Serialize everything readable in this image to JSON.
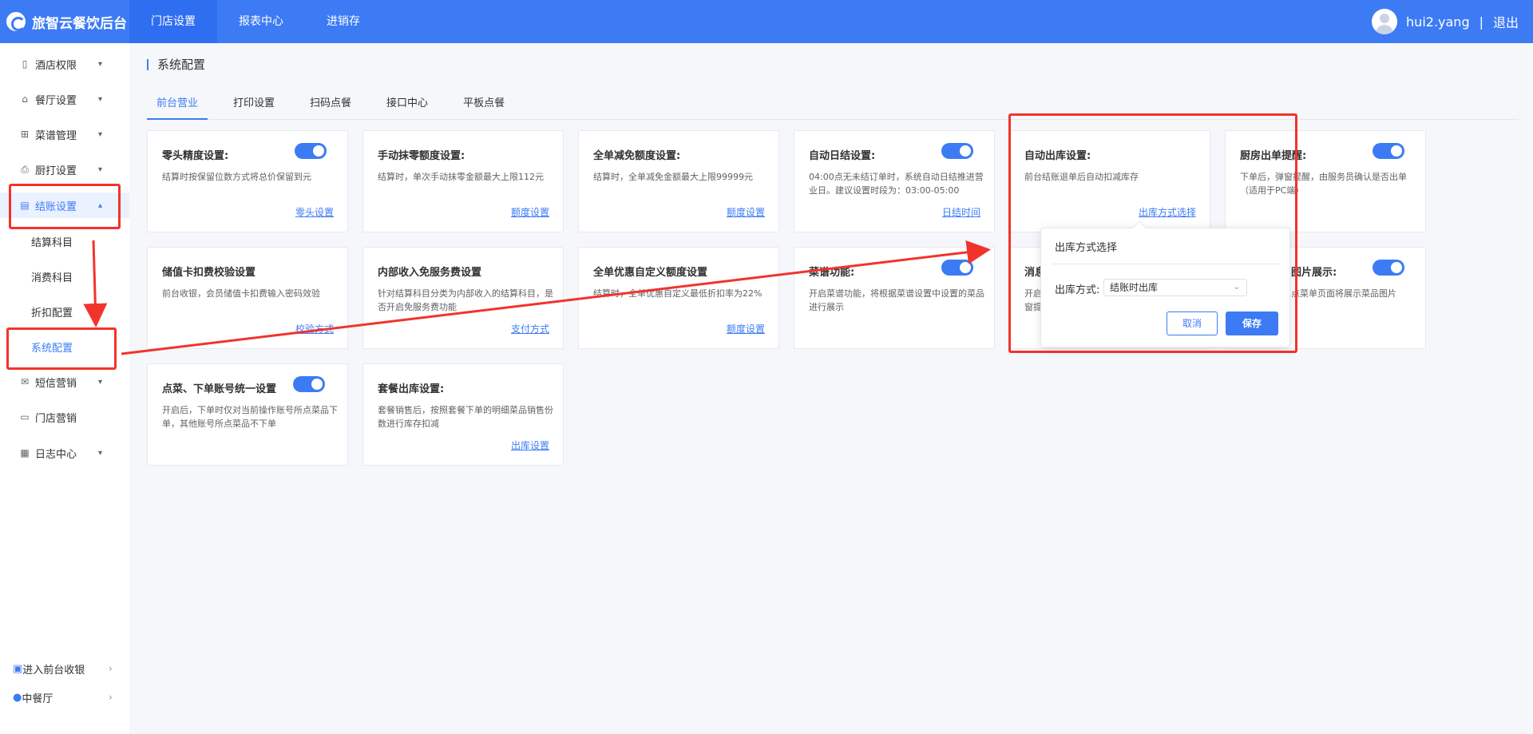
{
  "app": {
    "title": "旅智云餐饮后台"
  },
  "topnav": [
    {
      "label": "门店设置",
      "active": true
    },
    {
      "label": "报表中心",
      "active": false
    },
    {
      "label": "进销存",
      "active": false
    }
  ],
  "user": {
    "name": "hui2.yang",
    "separator": "|",
    "logout": "退出"
  },
  "sidebar": {
    "items": [
      {
        "label": "酒店权限",
        "icon": "building-icon"
      },
      {
        "label": "餐厅设置",
        "icon": "home-icon"
      },
      {
        "label": "菜谱管理",
        "icon": "grid-icon"
      },
      {
        "label": "厨打设置",
        "icon": "printer-icon"
      },
      {
        "label": "结账设置",
        "icon": "bill-icon",
        "open": true
      },
      {
        "label": "短信营销",
        "icon": "mail-icon"
      },
      {
        "label": "门店营销",
        "icon": "store-icon"
      },
      {
        "label": "日志中心",
        "icon": "log-icon"
      }
    ],
    "sub_items": [
      {
        "label": "结算科目"
      },
      {
        "label": "消费科目"
      },
      {
        "label": "折扣配置"
      },
      {
        "label": "系统配置",
        "active": true
      }
    ],
    "bottom": [
      {
        "label": "进入前台收银",
        "icon": "monitor-icon"
      },
      {
        "label": "中餐厅",
        "icon": "location-icon"
      }
    ]
  },
  "page": {
    "title": "系统配置",
    "tabs": [
      {
        "label": "前台营业",
        "active": true
      },
      {
        "label": "打印设置",
        "active": false
      },
      {
        "label": "扫码点餐",
        "active": false
      },
      {
        "label": "接口中心",
        "active": false
      },
      {
        "label": "平板点餐",
        "active": false
      }
    ]
  },
  "cards": [
    {
      "title": "零头精度设置:",
      "desc": "结算时按保留位数方式将总价保留到元",
      "link": "零头设置",
      "toggle": true
    },
    {
      "title": "手动抹零额度设置:",
      "desc": "结算时，单次手动抹零金额最大上限112元",
      "link": "额度设置",
      "toggle": false
    },
    {
      "title": "全单减免额度设置:",
      "desc": "结算时，全单减免金额最大上限99999元",
      "link": "额度设置",
      "toggle": false
    },
    {
      "title": "自动日结设置:",
      "desc": "04:00点无未结订单时，系统自动日结推进营业日。建议设置时段为：03:00-05:00",
      "link": "日结时间",
      "toggle": true
    },
    {
      "title": "自动出库设置:",
      "desc": "前台结账退单后自动扣减库存",
      "link": "出库方式选择",
      "toggle": false
    },
    {
      "title": "厨房出单提醒:",
      "desc": "下单后，弹窗提醒，由服务员确认是否出单（适用于PC端）",
      "link": "",
      "toggle": true
    },
    {
      "title": "储值卡扣费校验设置",
      "desc": "前台收银，会员储值卡扣费输入密码效验",
      "link": "校验方式",
      "toggle": false
    },
    {
      "title": "内部收入免服务费设置",
      "desc": "针对结算科目分类为内部收入的结算科目，是否开启免服务费功能",
      "link": "支付方式",
      "toggle": false
    },
    {
      "title": "全单优惠自定义额度设置",
      "desc": "结算时，全单优惠自定义最低折扣率为22%",
      "link": "额度设置",
      "toggle": false
    },
    {
      "title": "菜谱功能:",
      "desc": "开启菜谱功能，将根据菜谱设置中设置的菜品进行展示",
      "link": "",
      "toggle": true
    },
    {
      "title": "消息",
      "desc": "开启窗提",
      "link": "",
      "toggle": false
    },
    {
      "title": "图片展示:",
      "desc": "点菜单页面将展示菜品图片",
      "link": "",
      "toggle": true
    },
    {
      "title": "点菜、下单账号统一设置",
      "desc": "开启后，下单时仅对当前操作账号所点菜品下单，其他账号所点菜品不下单",
      "link": "",
      "toggle": true
    },
    {
      "title": "套餐出库设置:",
      "desc": "套餐销售后，按照套餐下单的明细菜品销售份数进行库存扣减",
      "link": "出库设置",
      "toggle": false
    }
  ],
  "popover": {
    "title": "出库方式选择",
    "field_label": "出库方式:",
    "select_value": "结账时出库",
    "cancel": "取消",
    "save": "保存"
  },
  "colors": {
    "primary": "#3d7bf5",
    "annotation": "#f0342c"
  }
}
